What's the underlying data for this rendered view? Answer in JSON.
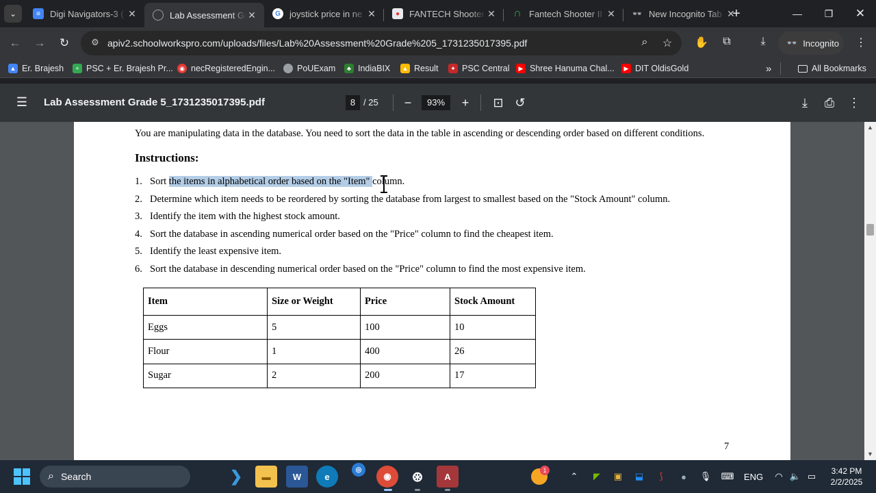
{
  "tabs": [
    {
      "title": "Digi Navigators-3 (",
      "favicon": "docs-icon",
      "active": false
    },
    {
      "title": "Lab Assessment Gr",
      "favicon": "globe-icon",
      "active": true
    },
    {
      "title": "joystick price in ne",
      "favicon": "google-icon",
      "active": false
    },
    {
      "title": "FANTECH Shooter",
      "favicon": "fantech-icon",
      "active": false
    },
    {
      "title": "Fantech Shooter II",
      "favicon": "fantech-arc-icon",
      "active": false
    },
    {
      "title": "New Incognito Tab",
      "favicon": "incognito-icon",
      "active": false
    }
  ],
  "omnibox": {
    "url": "apiv2.schoolworkspro.com/uploads/files/Lab%20Assessment%20Grade%205_1731235017395.pdf"
  },
  "profile": {
    "label": "Incognito"
  },
  "bookmarks": {
    "items": [
      {
        "label": "Er. Brajesh",
        "color": "#4285f4"
      },
      {
        "label": "PSC + Er. Brajesh Pr...",
        "color": "#34a853"
      },
      {
        "label": "necRegisteredEngin...",
        "color": "#e53935"
      },
      {
        "label": "PoUExam",
        "color": "#9aa0a6"
      },
      {
        "label": "IndiaBIX",
        "color": "#2e7d32"
      },
      {
        "label": "Result",
        "color": "#fbbc04"
      },
      {
        "label": "PSC Central",
        "color": "#c62828"
      },
      {
        "label": "Shree Hanuma Chal...",
        "color": "#ff0000"
      },
      {
        "label": "DIT OldisGold",
        "color": "#ff0000"
      }
    ],
    "more": "»",
    "all_label": "All Bookmarks"
  },
  "pdf": {
    "title": "Lab Assessment Grade 5_1731235017395.pdf",
    "page_current": "8",
    "page_total": "/ 25",
    "zoom": "93%"
  },
  "document": {
    "intro": "You are manipulating data in the database. You need to sort the data in the table in ascending or descending order based on different conditions.",
    "heading": "Instructions:",
    "steps": [
      {
        "num": "1.",
        "before": "Sort ",
        "highlight": "the items in alphabetical order based on the \"Item\" ",
        "after": "column."
      },
      {
        "num": "2.",
        "before": "Determine which item needs to be reordered by sorting the database from largest to smallest based on the \"Stock Amount\" column.",
        "highlight": "",
        "after": ""
      },
      {
        "num": "3.",
        "before": "Identify the item with the highest stock amount.",
        "highlight": "",
        "after": ""
      },
      {
        "num": "4.",
        "before": "Sort the database in ascending numerical order based on the \"Price\" column to find the cheapest item.",
        "highlight": "",
        "after": ""
      },
      {
        "num": "5.",
        "before": "Identify the least expensive item.",
        "highlight": "",
        "after": ""
      },
      {
        "num": "6.",
        "before": "Sort the database in descending numerical order based on the \"Price\" column to find the most expensive item.",
        "highlight": "",
        "after": ""
      }
    ],
    "table": {
      "headers": [
        "Item",
        "Size or Weight",
        "Price",
        "Stock Amount"
      ],
      "rows": [
        [
          "Eggs",
          "5",
          "100",
          "10"
        ],
        [
          "Flour",
          "1",
          "400",
          "26"
        ],
        [
          "Sugar",
          "2",
          "200",
          "17"
        ]
      ]
    },
    "page_number": "7"
  },
  "taskbar": {
    "search_label": "Search",
    "notification_count": "1",
    "language": "ENG",
    "time": "3:42 PM",
    "date": "2/2/2025"
  }
}
